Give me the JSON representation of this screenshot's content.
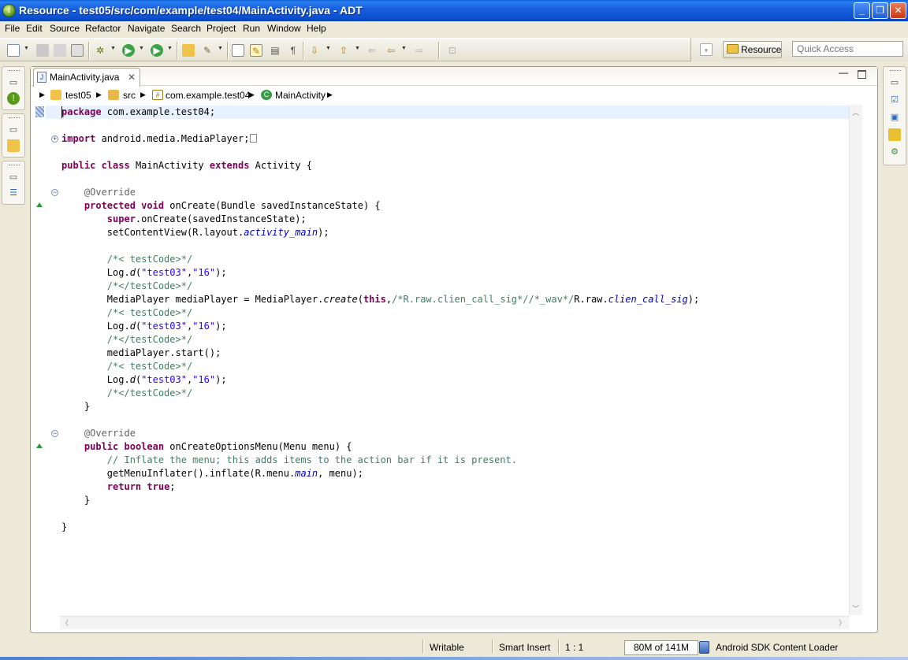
{
  "window": {
    "title": "Resource - test05/src/com/example/test04/MainActivity.java - ADT",
    "minimize_label": "_",
    "restore_label": "❐",
    "close_label": "✕"
  },
  "menu": {
    "items": [
      "File",
      "Edit",
      "Source",
      "Refactor",
      "Navigate",
      "Search",
      "Project",
      "Run",
      "Window",
      "Help"
    ]
  },
  "toolbar": {
    "perspective_label": "Resource",
    "quick_access_placeholder": "Quick Access"
  },
  "editor": {
    "tab_label": "MainActivity.java",
    "tab_close": "✕",
    "breadcrumb": [
      "test05",
      "src",
      "com.example.test04",
      "MainActivity"
    ]
  },
  "code": {
    "line1_kw": "package",
    "line1_rest": " com.example.test04;",
    "line2_kw": "import",
    "line2_rest": " android.media.MediaPlayer;",
    "line3_kw1": "public",
    "line3_kw2": "class",
    "line3_mid": " MainActivity ",
    "line3_kw3": "extends",
    "line3_rest": " Activity {",
    "override": "@Override",
    "oncreate_kw1": "protected",
    "oncreate_kw2": "void",
    "oncreate_rest": " onCreate(Bundle savedInstanceState) {",
    "super_kw": "super",
    "super_rest": ".onCreate(savedInstanceState);",
    "setcontent_a": "setContentView(R.layout.",
    "setcontent_b": "activity_main",
    "setcontent_c": ");",
    "testcode_open": "/*< testCode>*/",
    "testcode_close": "/*</testCode>*/",
    "log_a": "Log.",
    "log_b": "d",
    "log_c": "(",
    "log_s1": "\"test03\"",
    "log_comma": ",",
    "log_s2": "\"16\"",
    "log_end": ");",
    "mp_a": "MediaPlayer mediaPlayer = MediaPlayer.",
    "mp_create": "create",
    "mp_paren": "(",
    "mp_this": "this",
    "mp_comma": ",",
    "mp_comment": "/*R.raw.clien_call_sig*//*_wav*/",
    "mp_rraw": "R.raw.",
    "mp_field": "clien_call_sig",
    "mp_end": ");",
    "start_line": "mediaPlayer.start();",
    "close_brace": "}",
    "menu_kw1": "public",
    "menu_kw2": "boolean",
    "menu_rest": " onCreateOptionsMenu(Menu menu) {",
    "inflate_comment": "// Inflate the menu; this adds items to the action bar if it is present.",
    "inflate_a": "getMenuInflater().inflate(R.menu.",
    "inflate_b": "main",
    "inflate_c": ", menu);",
    "return_kw1": "return",
    "return_kw2": "true",
    "return_end": ";"
  },
  "status": {
    "writable": "Writable",
    "insert_mode": "Smart Insert",
    "position": "1 : 1",
    "heap": "80M of 141M",
    "heap_used_fraction": 0.567,
    "loader": "Android SDK Content Loader"
  },
  "colors": {
    "keyword": "#7f0055",
    "string": "#2a00ff",
    "comment": "#3f7f5f",
    "field": "#0000c0",
    "current_line": "#e8f2fe"
  }
}
